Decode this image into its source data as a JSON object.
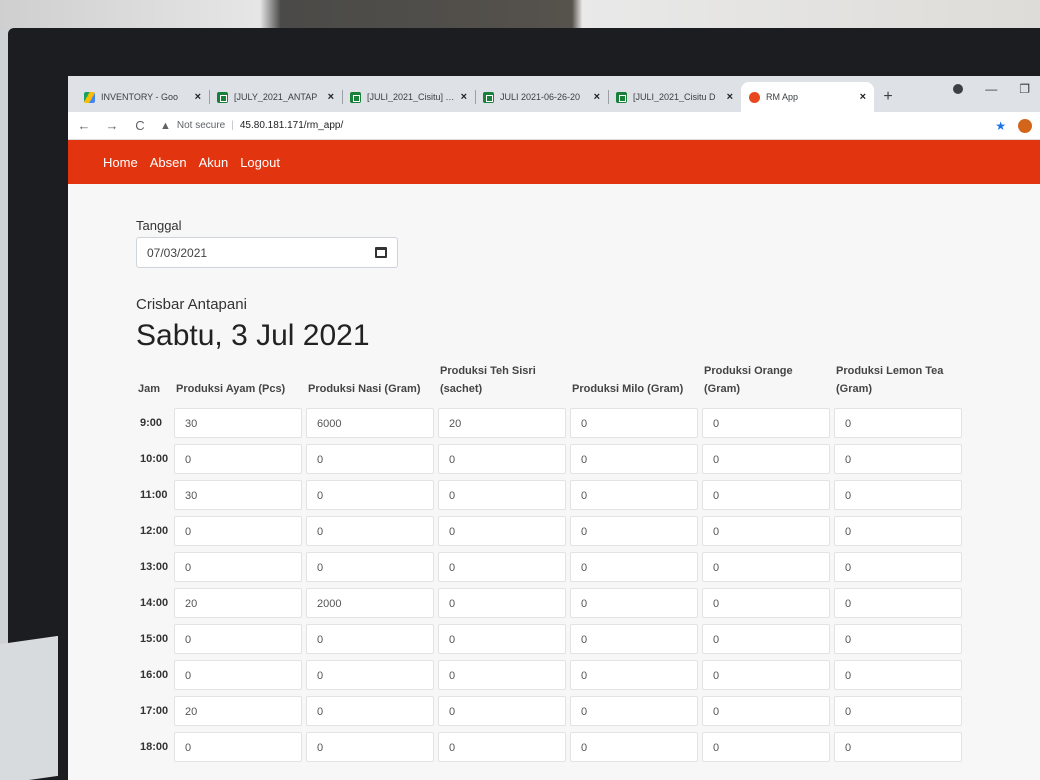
{
  "browser": {
    "tabs": [
      {
        "label": "INVENTORY - Goo",
        "icon": "drive-icon",
        "active": false
      },
      {
        "label": "[JULY_2021_ANTAP",
        "icon": "sheets-icon",
        "active": false
      },
      {
        "label": "[JULI_2021_Cisitu] Ta",
        "icon": "sheets-icon",
        "active": false
      },
      {
        "label": "JULI 2021-06-26-20",
        "icon": "sheets-icon",
        "active": false
      },
      {
        "label": "[JULI_2021_Cisitu D",
        "icon": "sheets-icon",
        "active": false
      },
      {
        "label": "RM App",
        "icon": "app-icon",
        "active": true
      }
    ],
    "security_label": "Not secure",
    "url": "45.80.181.171/rm_app/"
  },
  "nav": {
    "items": [
      "Home",
      "Absen",
      "Akun",
      "Logout"
    ]
  },
  "form": {
    "date_label": "Tanggal",
    "date_value": "07/03/2021"
  },
  "branch_name": "Crisbar Antapani",
  "day_title": "Sabtu, 3 Jul 2021",
  "table": {
    "headers": [
      "Jam",
      "Produksi Ayam (Pcs)",
      "Produksi Nasi (Gram)",
      "Produksi Teh Sisri (sachet)",
      "Produksi Milo (Gram)",
      "Produksi Orange (Gram)",
      "Produksi Lemon Tea (Gram)"
    ],
    "rows": [
      {
        "hour": "9:00",
        "values": [
          "30",
          "6000",
          "20",
          "0",
          "0",
          "0"
        ]
      },
      {
        "hour": "10:00",
        "values": [
          "0",
          "0",
          "0",
          "0",
          "0",
          "0"
        ]
      },
      {
        "hour": "11:00",
        "values": [
          "30",
          "0",
          "0",
          "0",
          "0",
          "0"
        ]
      },
      {
        "hour": "12:00",
        "values": [
          "0",
          "0",
          "0",
          "0",
          "0",
          "0"
        ]
      },
      {
        "hour": "13:00",
        "values": [
          "0",
          "0",
          "0",
          "0",
          "0",
          "0"
        ]
      },
      {
        "hour": "14:00",
        "values": [
          "20",
          "2000",
          "0",
          "0",
          "0",
          "0"
        ]
      },
      {
        "hour": "15:00",
        "values": [
          "0",
          "0",
          "0",
          "0",
          "0",
          "0"
        ]
      },
      {
        "hour": "16:00",
        "values": [
          "0",
          "0",
          "0",
          "0",
          "0",
          "0"
        ]
      },
      {
        "hour": "17:00",
        "values": [
          "20",
          "0",
          "0",
          "0",
          "0",
          "0"
        ]
      },
      {
        "hour": "18:00",
        "values": [
          "0",
          "0",
          "0",
          "0",
          "0",
          "0"
        ]
      }
    ]
  },
  "colors": {
    "navbar": "#e2340f",
    "page_bg": "#f7f7f7"
  }
}
